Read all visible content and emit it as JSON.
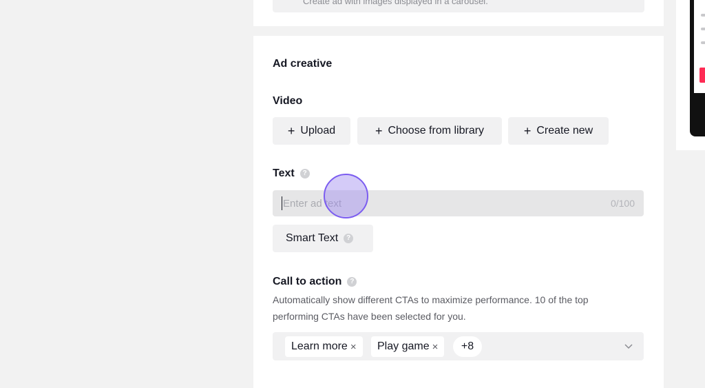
{
  "carousel_note": "Create ad with images displayed in a carousel.",
  "ad_creative": {
    "title": "Ad creative",
    "video": {
      "label": "Video",
      "buttons": [
        {
          "icon": "+",
          "label": "Upload"
        },
        {
          "icon": "+",
          "label": "Choose from library"
        },
        {
          "icon": "+",
          "label": "Create new"
        }
      ]
    },
    "text": {
      "label": "Text",
      "help_icon": "question-icon",
      "value": "",
      "placeholder": "Enter ad text",
      "counter": "0/100",
      "smart_text_label": "Smart Text"
    },
    "cta": {
      "label": "Call to action",
      "description": "Automatically show different CTAs to maximize performance. 10 of the top performing CTAs have been selected for you.",
      "tags": [
        {
          "label": "Learn more",
          "remove": "×"
        },
        {
          "label": "Play game",
          "remove": "×"
        }
      ],
      "more_count": "+8",
      "dropdown_icon": "chevron-down-icon"
    }
  },
  "colors": {
    "accent_cursor": "#7b5cf0",
    "preview_red": "#fe2c55"
  }
}
